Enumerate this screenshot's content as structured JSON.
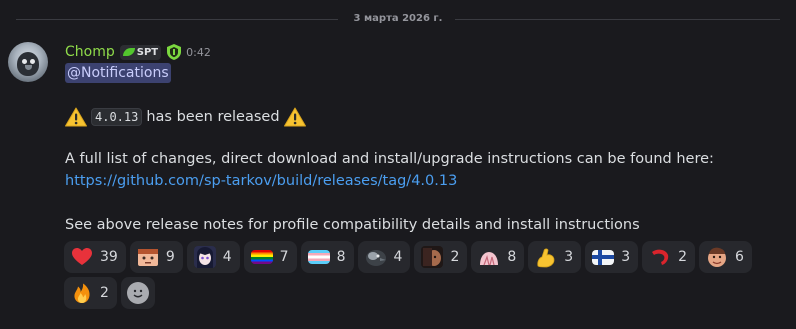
{
  "divider": {
    "date": "3 марта 2026 г."
  },
  "message": {
    "username": "Chomp",
    "tag": "SPT",
    "time": "0:42",
    "mention": "@Notifications",
    "version": "4.0.13",
    "released_text": "has been released",
    "description": "A full list of changes, direct download and install/upgrade instructions can be found here:",
    "link": "https://github.com/sp-tarkov/build/releases/tag/4.0.13",
    "footer": "See above release notes for profile compatibility details and install instructions"
  },
  "reactions": [
    {
      "icon": "red-heart-icon",
      "count": "39"
    },
    {
      "icon": "custom-face-emoji-icon",
      "count": "9"
    },
    {
      "icon": "anime-girl-emoji-icon",
      "count": "4"
    },
    {
      "icon": "rainbow-flag-icon",
      "count": "7"
    },
    {
      "icon": "transgender-flag-icon",
      "count": "8"
    },
    {
      "icon": "crow-emoji-icon",
      "count": "4"
    },
    {
      "icon": "character-emoji-icon",
      "count": "2"
    },
    {
      "icon": "pink-blob-emoji-icon",
      "count": "8"
    },
    {
      "icon": "flexed-biceps-icon",
      "count": "3"
    },
    {
      "icon": "finland-flag-icon",
      "count": "3"
    },
    {
      "icon": "red-shrimp-emoji-icon",
      "count": "2"
    },
    {
      "icon": "face-emoji-icon",
      "count": "6"
    },
    {
      "icon": "fire-icon",
      "count": "2"
    }
  ],
  "colors": {
    "background": "#1a1a1e",
    "username": "#8fdb4a",
    "link": "#4b9ef0",
    "mention_bg": "#3c4270",
    "reaction_bg": "#27282d"
  }
}
